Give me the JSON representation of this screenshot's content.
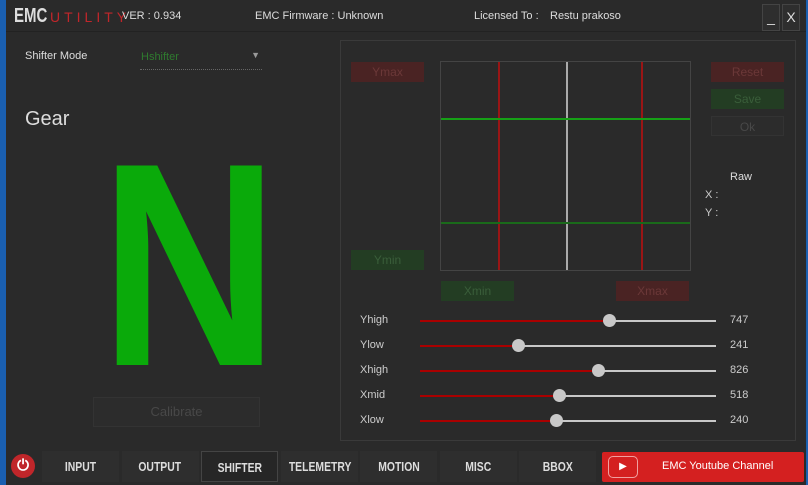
{
  "title": {
    "brand": "EMC",
    "brand_sub": "UTILITY",
    "version": "VER : 0.934",
    "firmware": "EMC Firmware : Unknown",
    "licensed_label": "Licensed To :",
    "licensed_name": "Restu prakoso",
    "minimize": "_",
    "close": "X"
  },
  "left": {
    "shifter_mode_label": "Shifter Mode",
    "shifter_mode_value": "Hshifter",
    "gear_label": "Gear",
    "gear_value": "N",
    "calibrate": "Calibrate"
  },
  "calib": {
    "ymax": "Ymax",
    "ymin": "Ymin",
    "xmin": "Xmin",
    "xmax": "Xmax",
    "reset": "Reset",
    "save": "Save",
    "ok": "Ok",
    "raw": "Raw",
    "x_label": "X :",
    "y_label": "Y :"
  },
  "sliders": [
    {
      "label": "Yhigh",
      "value": "747",
      "fraction": 0.64
    },
    {
      "label": "Ylow",
      "value": "241",
      "fraction": 0.33
    },
    {
      "label": "Xhigh",
      "value": "826",
      "fraction": 0.6
    },
    {
      "label": "Xmid",
      "value": "518",
      "fraction": 0.47
    },
    {
      "label": "Xlow",
      "value": "240",
      "fraction": 0.46
    }
  ],
  "nav": {
    "tabs": [
      "INPUT",
      "OUTPUT",
      "SHIFTER",
      "TELEMETRY",
      "MOTION",
      "MISC",
      "BBOX"
    ],
    "active": "SHIFTER",
    "youtube": "EMC Youtube Channel"
  },
  "colors": {
    "accent_red": "#c0262a",
    "gear_green": "#0aaa0a"
  }
}
